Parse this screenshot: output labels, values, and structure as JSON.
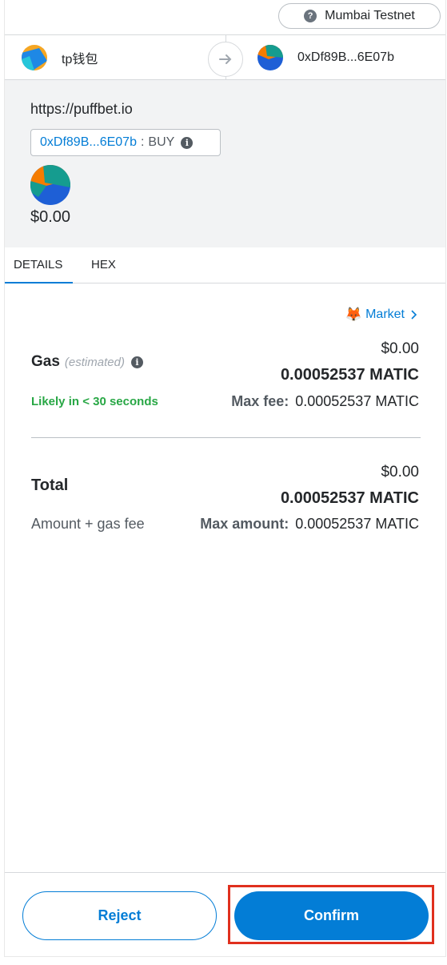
{
  "network": {
    "label": "Mumbai Testnet",
    "icon": "question-icon"
  },
  "accounts": {
    "from_name": "tp钱包",
    "to_address": "0xDf89B...6E07b",
    "arrow_icon": "arrow-right-icon"
  },
  "origin": {
    "url": "https://puffbet.io",
    "method_address": "0xDf89B...6E07b",
    "method_separator": ":",
    "method_name": "BUY",
    "info_icon": "info-icon",
    "amount": "$0.00"
  },
  "tabs": [
    {
      "label": "DETAILS",
      "active": true
    },
    {
      "label": "HEX",
      "active": false
    }
  ],
  "details": {
    "market_label": "Market",
    "market_icon": "fox-icon",
    "gas": {
      "label": "Gas",
      "sub_label": "(estimated)",
      "usd": "$0.00",
      "native": "0.00052537 MATIC",
      "likely": "Likely in < 30 seconds",
      "max_fee_label": "Max fee:",
      "max_fee_value": "0.00052537 MATIC"
    },
    "total": {
      "label": "Total",
      "usd": "$0.00",
      "native": "0.00052537 MATIC",
      "sub_label": "Amount + gas fee",
      "max_amount_label": "Max amount:",
      "max_amount_value": "0.00052537 MATIC"
    }
  },
  "footer": {
    "reject_label": "Reject",
    "confirm_label": "Confirm"
  },
  "colors": {
    "accent": "#037dd6",
    "success": "#28a745",
    "highlight": "#e0301e",
    "panel": "#f2f3f4"
  }
}
